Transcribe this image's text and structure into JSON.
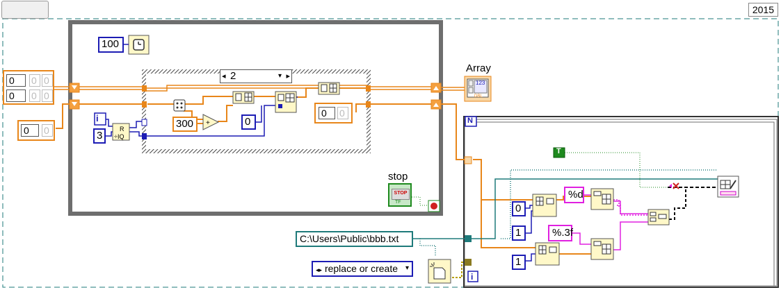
{
  "toolbar": {
    "tools": [
      "hand-icon",
      "arrow-icon",
      "run-icon"
    ]
  },
  "year": "2015",
  "while_loop": {
    "timer_constant": "100",
    "case_selector": "2",
    "iteration_index": "i",
    "divisor_constant": "3",
    "random_offset": "300",
    "insert_index": "0",
    "stop_label": "stop",
    "stop_button": "STOP",
    "stop_tf": "TF",
    "shift_register_init": "0"
  },
  "left_controls": {
    "array_2d_values": [
      "0",
      "0"
    ],
    "array_2d_ghost": [
      "0",
      "0",
      "0",
      "0"
    ],
    "array_1d_value": "0",
    "array_1d_ghost": "0"
  },
  "indicator": {
    "label": "Array",
    "type_text": "123",
    "dbl": "DBL"
  },
  "for_loop": {
    "count_terminal": "N",
    "index_terminal": "i",
    "true_constant": "T",
    "format_int": "%d",
    "format_float": "%.3f",
    "index_zero": "0",
    "index_one_a": "1",
    "index_one_b": "1"
  },
  "file": {
    "path": "C:\\Users\\Public\\bbb.txt",
    "operation": "replace or create"
  },
  "colors": {
    "orange_wire": "#e8861a",
    "blue_wire": "#1c1cb4",
    "pink_wire": "#e020e0",
    "teal_wire": "#1e7a7a",
    "green_wire": "#1e8a1e",
    "loop_frame": "#6e6e6e"
  }
}
